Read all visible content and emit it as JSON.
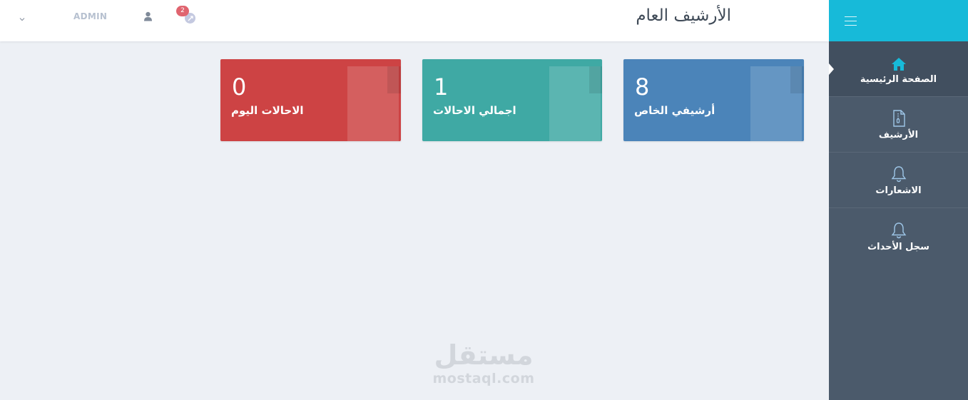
{
  "header": {
    "title": "الأرشيف العام",
    "user_name": "ADMIN",
    "notification_count": "2",
    "icons": [
      "chevron-down-icon",
      "user-icon",
      "notification-icon"
    ]
  },
  "sidebar": {
    "menu_icon": "hamburger-icon",
    "items": [
      {
        "label": "الصفحة الرئيسية",
        "icon": "home-icon",
        "active": true
      },
      {
        "label": "الأرشيف",
        "icon": "file-archive-icon",
        "active": false
      },
      {
        "label": "الاشعارات",
        "icon": "bell-icon",
        "active": false
      },
      {
        "label": "سجل الأحداث",
        "icon": "bell-icon",
        "active": false
      }
    ]
  },
  "cards": [
    {
      "value": "8",
      "label": "أرشيفي الخاص",
      "color": "#4b84b9"
    },
    {
      "value": "1",
      "label": "اجمالي الاحالات",
      "color": "#3fa9a4"
    },
    {
      "value": "0",
      "label": "الاحالات اليوم",
      "color": "#cd4344"
    }
  ],
  "watermark": {
    "arabic": "مستقل",
    "latin": "mostaql.com"
  },
  "colors": {
    "sidebar_bg": "#4b5a6b",
    "sidebar_top": "#17bad9",
    "page_bg": "#edf0f5"
  }
}
